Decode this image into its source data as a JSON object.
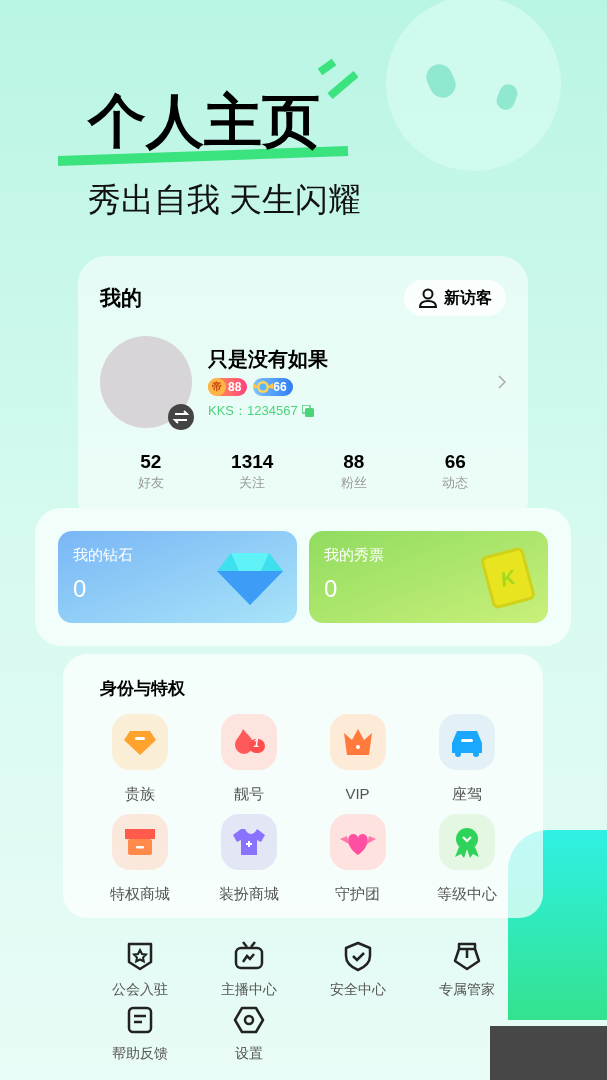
{
  "hero": {
    "title": "个人主页",
    "subtitle": "秀出自我 天生闪耀"
  },
  "profile": {
    "heading": "我的",
    "visitor_button": "新访客",
    "name": "只是没有如果",
    "badges": [
      {
        "kind": "noble",
        "icon_text": "帝",
        "value": "88"
      },
      {
        "kind": "level",
        "value": "66"
      }
    ],
    "id_text": "KKS：1234567",
    "stats": [
      {
        "value": "52",
        "label": "好友"
      },
      {
        "value": "1314",
        "label": "关注"
      },
      {
        "value": "88",
        "label": "粉丝"
      },
      {
        "value": "66",
        "label": "动态"
      }
    ]
  },
  "wallet": [
    {
      "kind": "diamond",
      "title": "我的钻石",
      "value": "0"
    },
    {
      "kind": "ticket",
      "title": "我的秀票",
      "value": "0",
      "icon_text": "K"
    }
  ],
  "privileges": {
    "title": "身份与特权",
    "items": [
      {
        "kind": "noble",
        "label": "贵族"
      },
      {
        "kind": "number",
        "label": "靓号",
        "icon_text": "1"
      },
      {
        "kind": "vip",
        "label": "VIP"
      },
      {
        "kind": "car",
        "label": "座驾"
      },
      {
        "kind": "shop",
        "label": "特权商城"
      },
      {
        "kind": "outfit",
        "label": "装扮商城"
      },
      {
        "kind": "guard",
        "label": "守护团"
      },
      {
        "kind": "level",
        "label": "等级中心"
      }
    ]
  },
  "tools": [
    {
      "kind": "guild",
      "label": "公会入驻"
    },
    {
      "kind": "tv",
      "label": "主播中心"
    },
    {
      "kind": "shield",
      "label": "安全中心"
    },
    {
      "kind": "pen",
      "label": "专属管家"
    },
    {
      "kind": "note",
      "label": "帮助反馈"
    },
    {
      "kind": "settings",
      "label": "设置"
    }
  ]
}
